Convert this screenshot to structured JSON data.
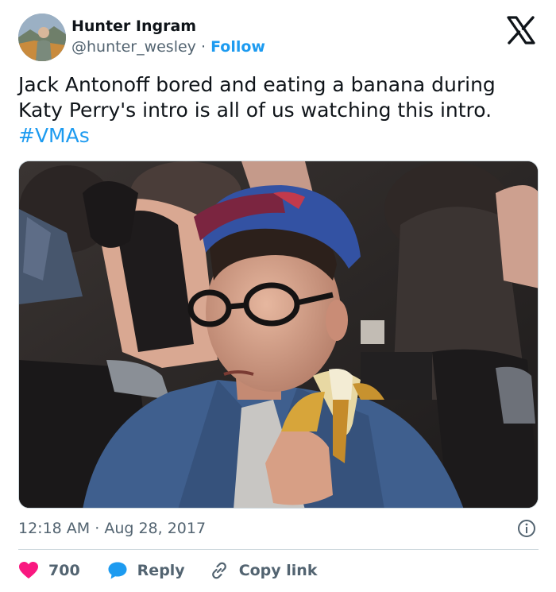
{
  "author": {
    "name": "Hunter Ingram",
    "handle": "@hunter_wesley",
    "separator": "·",
    "follow_label": "Follow"
  },
  "tweet": {
    "text_line1": "Jack Antonoff bored and eating a banana during",
    "text_line2": "Katy Perry's intro is all of us watching this intro.",
    "hashtag": "#VMAs"
  },
  "meta": {
    "time": "12:18 AM",
    "separator": "·",
    "date": "Aug 28, 2017"
  },
  "actions": {
    "like_count": "700",
    "reply_label": "Reply",
    "copy_label": "Copy link"
  },
  "icons": {
    "logo": "x-logo-icon",
    "like": "heart-icon",
    "reply": "reply-bubble-icon",
    "copy": "link-icon",
    "info": "info-icon"
  },
  "colors": {
    "accent": "#1d9bf0",
    "heart": "#f91880",
    "text": "#0f1419",
    "secondary": "#536471",
    "border": "#cfd9de"
  }
}
